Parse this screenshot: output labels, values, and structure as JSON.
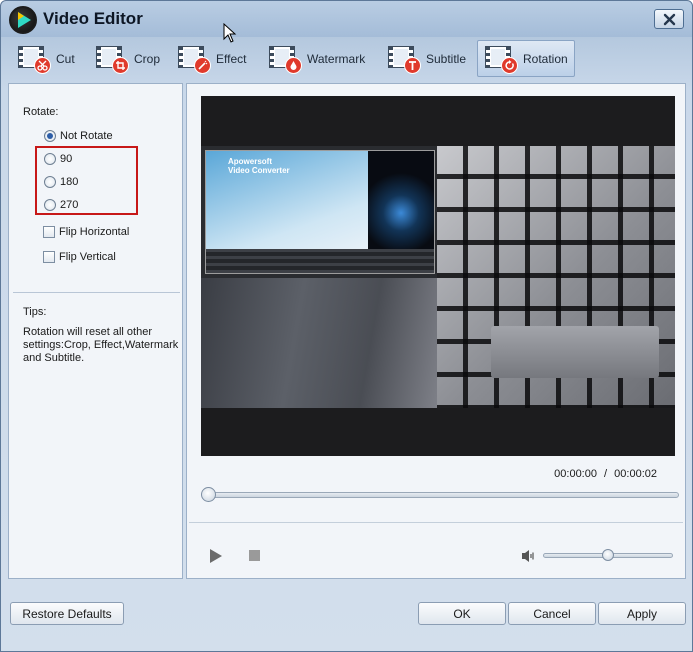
{
  "window": {
    "title": "Video Editor"
  },
  "toolbar": {
    "tabs": [
      {
        "label": "Cut",
        "icon": "scissors-icon",
        "active": false
      },
      {
        "label": "Crop",
        "icon": "crop-icon",
        "active": false
      },
      {
        "label": "Effect",
        "icon": "magic-wand-icon",
        "active": false
      },
      {
        "label": "Watermark",
        "icon": "droplet-icon",
        "active": false
      },
      {
        "label": "Subtitle",
        "icon": "text-t-icon",
        "active": false
      },
      {
        "label": "Rotation",
        "icon": "rotate-icon",
        "active": true
      }
    ]
  },
  "rotate": {
    "heading": "Rotate:",
    "options": [
      "Not Rotate",
      "90",
      "180",
      "270"
    ],
    "selected": "Not Rotate",
    "flip_horizontal": "Flip Horizontal",
    "flip_vertical": "Flip Vertical"
  },
  "tips": {
    "heading": "Tips:",
    "text": "Rotation will reset all other settings:Crop, Effect,Watermark and Subtitle."
  },
  "preview": {
    "overlay_title_line1": "Apowersoft",
    "overlay_title_line2": "Video Converter",
    "current_time": "00:00:00",
    "separator": "/",
    "total_time": "00:00:02",
    "seek_progress": 0,
    "volume_level": 0.5
  },
  "footer": {
    "restore_defaults": "Restore Defaults",
    "ok": "OK",
    "cancel": "Cancel",
    "apply": "Apply"
  },
  "colors": {
    "accent": "#2d5ea8",
    "highlight_box": "#c71818",
    "active_tab_bg": "#bcd0e8"
  }
}
